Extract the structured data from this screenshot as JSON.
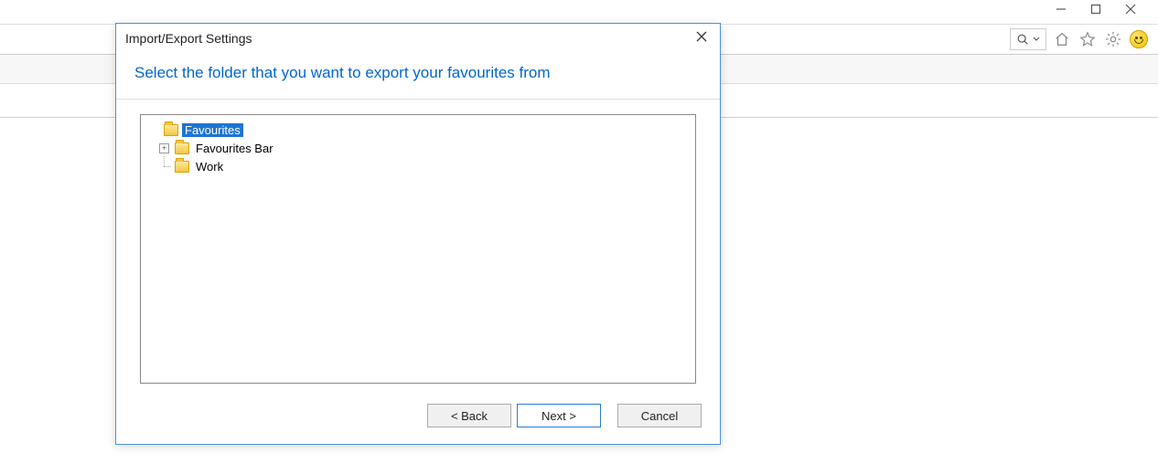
{
  "dialog": {
    "title": "Import/Export Settings",
    "heading": "Select the folder that you want to export your favourites from",
    "tree": {
      "root": {
        "label": "Favourites",
        "selected": true
      },
      "children": [
        {
          "label": "Favourites Bar",
          "expandable": true
        },
        {
          "label": "Work",
          "expandable": false
        }
      ]
    },
    "buttons": {
      "back": "< Back",
      "next": "Next >",
      "cancel": "Cancel"
    }
  },
  "toolbar": {
    "icons": {
      "search": "search-icon",
      "dropdown": "dropdown-icon",
      "home": "home-icon",
      "star": "favourites-icon",
      "gear": "settings-icon",
      "smiley": "feedback-icon"
    }
  }
}
